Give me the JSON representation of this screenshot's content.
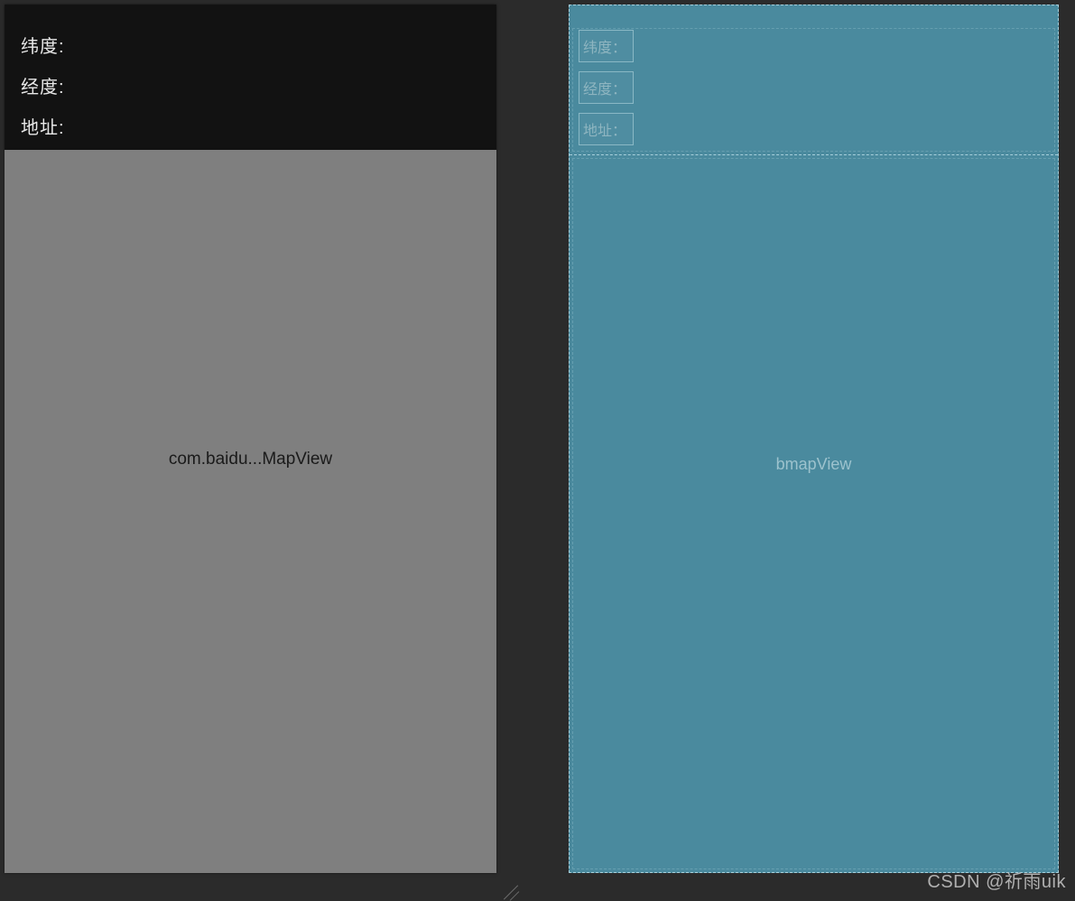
{
  "left_panel": {
    "labels": {
      "latitude": "纬度:",
      "longitude": "经度:",
      "address": "地址:"
    },
    "map_view_text": "com.baidu...MapView"
  },
  "right_panel": {
    "labels": {
      "latitude": "纬度：",
      "longitude": "经度：",
      "address": "地址："
    },
    "map_view_text": "bmapView"
  },
  "watermark": "CSDN @祈雨uik"
}
